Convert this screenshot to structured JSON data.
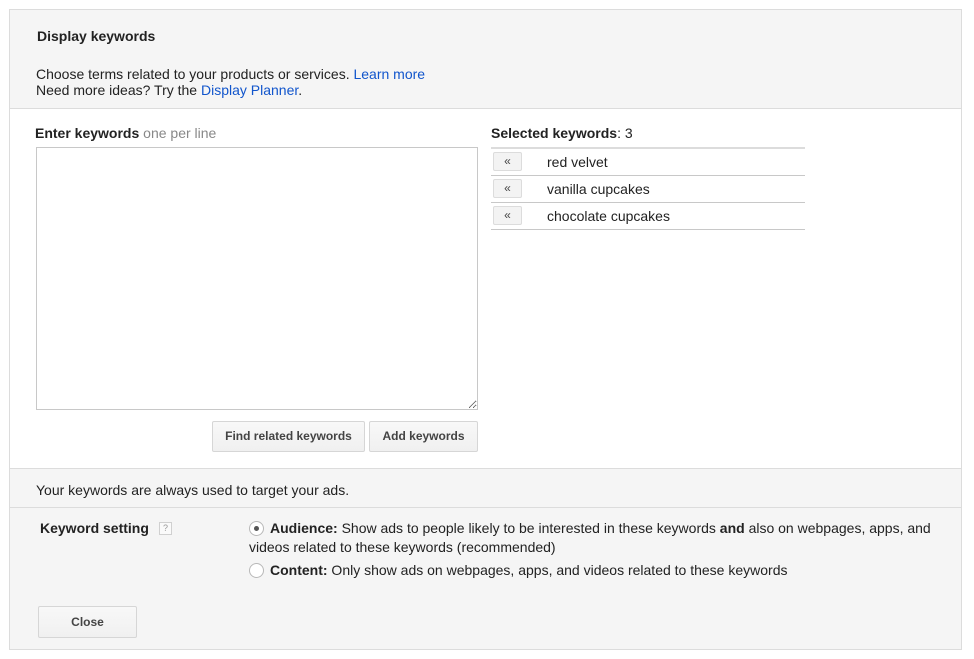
{
  "header": {
    "title": "Display keywords",
    "intro_line1": "Choose terms related to your products or services.",
    "learn_more": "Learn more",
    "intro_line2_prefix": "Need more ideas? Try the",
    "display_planner": "Display Planner",
    "intro_line2_suffix": "."
  },
  "editor": {
    "enter_label": "Enter keywords",
    "enter_hint": "one per line",
    "textarea_value": "",
    "find_related_label": "Find related keywords",
    "add_keywords_label": "Add keywords"
  },
  "selected": {
    "label": "Selected keywords",
    "count_text": ": 3",
    "remove_glyph": "«",
    "items": [
      "red velvet",
      "vanilla cupcakes",
      "chocolate cupcakes"
    ]
  },
  "notice": {
    "text": "Your keywords are always used to target your ads."
  },
  "setting": {
    "label": "Keyword setting",
    "help_glyph": "?",
    "options": [
      {
        "name": "Audience:",
        "desc_before": " Show ads to people likely to be interested in these keywords ",
        "desc_bold": "and",
        "desc_after": " also on webpages, apps, and videos related to these keywords (recommended)",
        "checked": true
      },
      {
        "name": "Content:",
        "desc_before": " Only show ads on webpages, apps, and videos related to these keywords",
        "desc_bold": "",
        "desc_after": "",
        "checked": false
      }
    ],
    "close_label": "Close"
  }
}
